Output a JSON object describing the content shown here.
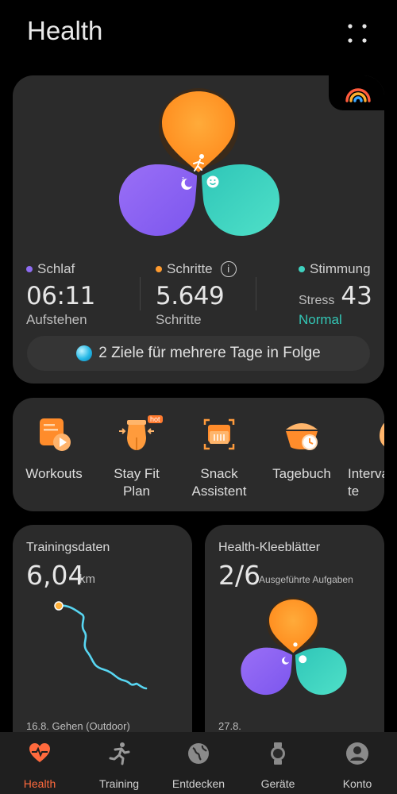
{
  "header": {
    "title": "Health"
  },
  "main_card": {
    "metrics": [
      {
        "label": "Schlaf",
        "value": "06:11",
        "sub": "Aufstehen",
        "color": "#8e6cf2"
      },
      {
        "label": "Schritte",
        "value": "5.649",
        "sub": "Schritte",
        "color": "#ff9b2f"
      },
      {
        "label": "Stimmung",
        "stress_label": "Stress",
        "value": "43",
        "sub": "Normal",
        "color": "#3fd1bf",
        "sub_color": "#33c7b6"
      }
    ],
    "info_glyph": "i",
    "goal_text": "2 Ziele für mehrere Tage in Folge"
  },
  "shortcuts": [
    {
      "label": "Workouts",
      "icon": "workouts-icon"
    },
    {
      "label": "Stay Fit\nPlan",
      "icon": "stay-fit-plan-icon",
      "badge": "hot"
    },
    {
      "label": "Snack\nAssistent",
      "icon": "snack-assistant-icon"
    },
    {
      "label": "Tagebuch",
      "icon": "diary-icon"
    },
    {
      "label": "Interva\nte",
      "icon": "interval-icon"
    }
  ],
  "training": {
    "title": "Trainingsdaten",
    "value": "6,04",
    "unit": "km",
    "footnote": "16.8.  Gehen (Outdoor)"
  },
  "klee": {
    "title": "Health-Kleeblätter",
    "value": "2/6",
    "unit": "Ausgeführte Aufgaben",
    "footnote": "27.8."
  },
  "tabs": [
    {
      "label": "Health",
      "icon": "health-heart-icon",
      "active": true
    },
    {
      "label": "Training",
      "icon": "running-icon",
      "active": false
    },
    {
      "label": "Entdecken",
      "icon": "globe-icon",
      "active": false
    },
    {
      "label": "Geräte",
      "icon": "watch-icon",
      "active": false
    },
    {
      "label": "Konto",
      "icon": "account-icon",
      "active": false
    }
  ],
  "colors": {
    "accent": "#ff6a3d",
    "orange": "#ff9b2f",
    "purple": "#8e6cf2",
    "teal": "#3fd1bf"
  }
}
